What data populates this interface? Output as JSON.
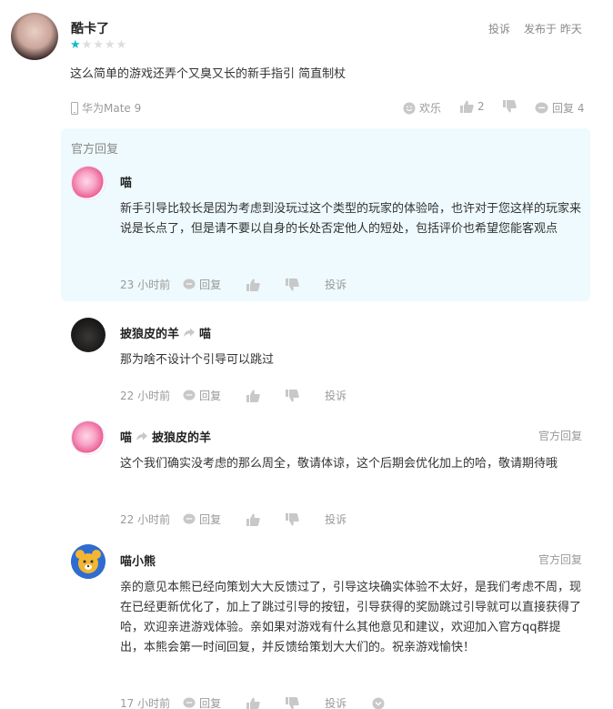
{
  "review": {
    "username": "酷卡了",
    "rating_filled": 1,
    "rating_total": 5,
    "report_label": "投诉",
    "posted_label": "发布于 昨天",
    "body": "这么简单的游戏还弄个又臭又长的新手指引 简直制杖",
    "device": "华为Mate 9",
    "happy_label": "欢乐",
    "like_count": "2",
    "reply_label": "回复 4"
  },
  "official_reply": {
    "label": "官方回复",
    "author": "喵",
    "body": "新手引导比较长是因为考虑到没玩过这个类型的玩家的体验哈，也许对于您这样的玩家来说是长点了，但是请不要以自身的长处否定他人的短处，包括评价也希望您能客观点",
    "time": "23 小时前",
    "reply_label": "回复",
    "report_label": "投诉"
  },
  "replies": [
    {
      "author": "披狼皮的羊",
      "reply_to": "喵",
      "body": "那为啥不设计个引导可以跳过",
      "time": "22 小时前",
      "reply_label": "回复",
      "report_label": "投诉",
      "tag": ""
    },
    {
      "author": "喵",
      "reply_to": "披狼皮的羊",
      "body": "这个我们确实没考虑的那么周全，敬请体谅，这个后期会优化加上的哈，敬请期待哦",
      "time": "22 小时前",
      "reply_label": "回复",
      "report_label": "投诉",
      "tag": "官方回复"
    },
    {
      "author": "喵小熊",
      "reply_to": "",
      "body": "亲的意见本熊已经向策划大大反馈过了，引导这块确实体验不太好，是我们考虑不周，现在已经更新优化了，加上了跳过引导的按钮，引导获得的奖励跳过引导就可以直接获得了哈，欢迎亲进游戏体验。亲如果对游戏有什么其他意见和建议，欢迎加入官方qq群提出，本熊会第一时间回复，并反馈给策划大大们的。祝亲游戏愉快！",
      "time": "17 小时前",
      "reply_label": "回复",
      "report_label": "投诉",
      "tag": "官方回复"
    }
  ],
  "colors": {
    "accent": "#14b9c8",
    "official_bg": "#eefafd",
    "muted": "#999999"
  }
}
